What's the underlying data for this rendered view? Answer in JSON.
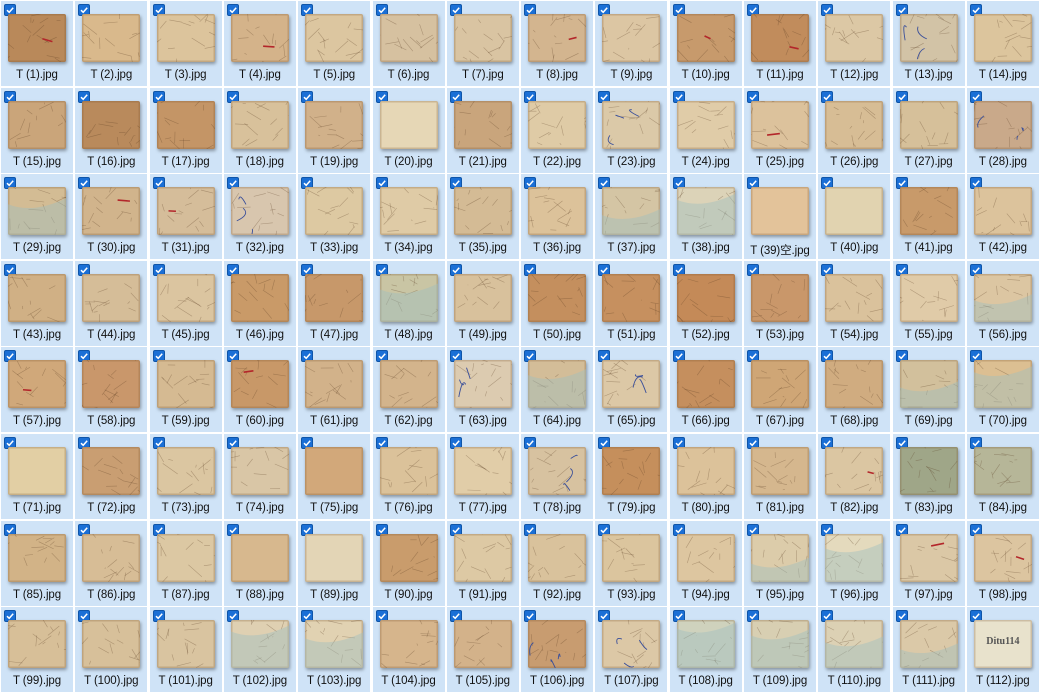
{
  "window": {
    "title": ""
  },
  "accent_color": "#1a6fd6",
  "selection_background": "#cfe3f7",
  "files": [
    {
      "name": "T (1).jpg",
      "selected": true,
      "tone": "#b9895a",
      "feature": "red"
    },
    {
      "name": "T (2).jpg",
      "selected": true,
      "tone": "#d9b98c",
      "feature": "lines"
    },
    {
      "name": "T (3).jpg",
      "selected": true,
      "tone": "#dcc49c",
      "feature": "lines"
    },
    {
      "name": "T (4).jpg",
      "selected": true,
      "tone": "#d4b38a",
      "feature": "red"
    },
    {
      "name": "T (5).jpg",
      "selected": true,
      "tone": "#dcc6a0",
      "feature": "lines"
    },
    {
      "name": "T (6).jpg",
      "selected": true,
      "tone": "#d6c1a0",
      "feature": "lines"
    },
    {
      "name": "T (7).jpg",
      "selected": true,
      "tone": "#d9c4a2",
      "feature": "lines"
    },
    {
      "name": "T (8).jpg",
      "selected": true,
      "tone": "#d3b58f",
      "feature": "red"
    },
    {
      "name": "T (9).jpg",
      "selected": true,
      "tone": "#dcc6a3",
      "feature": "lines"
    },
    {
      "name": "T (10).jpg",
      "selected": true,
      "tone": "#c79a6c",
      "feature": "red"
    },
    {
      "name": "T (11).jpg",
      "selected": true,
      "tone": "#c18c5c",
      "feature": "red"
    },
    {
      "name": "T (12).jpg",
      "selected": true,
      "tone": "#dcc8a5",
      "feature": "lines"
    },
    {
      "name": "T (13).jpg",
      "selected": true,
      "tone": "#d2c3a6",
      "feature": "blue"
    },
    {
      "name": "T (14).jpg",
      "selected": true,
      "tone": "#dcc59d",
      "feature": "lines"
    },
    {
      "name": "T (15).jpg",
      "selected": true,
      "tone": "#caa57a",
      "feature": "lines"
    },
    {
      "name": "T (16).jpg",
      "selected": true,
      "tone": "#b98a5c",
      "feature": "lines"
    },
    {
      "name": "T (17).jpg",
      "selected": true,
      "tone": "#c49566",
      "feature": "lines"
    },
    {
      "name": "T (18).jpg",
      "selected": true,
      "tone": "#d8c19b",
      "feature": "lines"
    },
    {
      "name": "T (19).jpg",
      "selected": true,
      "tone": "#d1b18a",
      "feature": "lines"
    },
    {
      "name": "T (20).jpg",
      "selected": true,
      "tone": "#e6d7b6",
      "feature": "plain"
    },
    {
      "name": "T (21).jpg",
      "selected": true,
      "tone": "#c9a57c",
      "feature": "lines"
    },
    {
      "name": "T (22).jpg",
      "selected": true,
      "tone": "#dfcba6",
      "feature": "lines"
    },
    {
      "name": "T (23).jpg",
      "selected": true,
      "tone": "#dbc9a8",
      "feature": "blue"
    },
    {
      "name": "T (24).jpg",
      "selected": true,
      "tone": "#e0cca8",
      "feature": "lines"
    },
    {
      "name": "T (25).jpg",
      "selected": true,
      "tone": "#dcc29c",
      "feature": "red"
    },
    {
      "name": "T (26).jpg",
      "selected": true,
      "tone": "#d7bd95",
      "feature": "lines"
    },
    {
      "name": "T (27).jpg",
      "selected": true,
      "tone": "#d6c09a",
      "feature": "lines"
    },
    {
      "name": "T (28).jpg",
      "selected": true,
      "tone": "#c9a98a",
      "feature": "blue"
    },
    {
      "name": "T (29).jpg",
      "selected": true,
      "tone": "#d3bc94",
      "feature": "water"
    },
    {
      "name": "T (30).jpg",
      "selected": true,
      "tone": "#d1b48c",
      "feature": "red"
    },
    {
      "name": "T (31).jpg",
      "selected": true,
      "tone": "#d5bd9a",
      "feature": "red"
    },
    {
      "name": "T (32).jpg",
      "selected": true,
      "tone": "#d8c6ae",
      "feature": "blue"
    },
    {
      "name": "T (33).jpg",
      "selected": true,
      "tone": "#ddc9a2",
      "feature": "lines"
    },
    {
      "name": "T (34).jpg",
      "selected": true,
      "tone": "#dfcba6",
      "feature": "lines"
    },
    {
      "name": "T (35).jpg",
      "selected": true,
      "tone": "#d4bb95",
      "feature": "lines"
    },
    {
      "name": "T (36).jpg",
      "selected": true,
      "tone": "#dcc29a",
      "feature": "lines"
    },
    {
      "name": "T (37).jpg",
      "selected": true,
      "tone": "#d4c5a4",
      "feature": "water"
    },
    {
      "name": "T (38).jpg",
      "selected": true,
      "tone": "#dcd3b8",
      "feature": "water"
    },
    {
      "name": "T (39)空.jpg",
      "selected": true,
      "tone": "#e3c39a",
      "feature": "plain"
    },
    {
      "name": "T (40).jpg",
      "selected": true,
      "tone": "#e1d3b0",
      "feature": "plain"
    },
    {
      "name": "T (41).jpg",
      "selected": true,
      "tone": "#c89a6a",
      "feature": "lines"
    },
    {
      "name": "T (42).jpg",
      "selected": true,
      "tone": "#dcc39c",
      "feature": "lines"
    },
    {
      "name": "T (43).jpg",
      "selected": true,
      "tone": "#d0b085",
      "feature": "lines"
    },
    {
      "name": "T (44).jpg",
      "selected": true,
      "tone": "#d5bd98",
      "feature": "lines"
    },
    {
      "name": "T (45).jpg",
      "selected": true,
      "tone": "#dbc5a0",
      "feature": "lines"
    },
    {
      "name": "T (46).jpg",
      "selected": true,
      "tone": "#c99a68",
      "feature": "lines"
    },
    {
      "name": "T (47).jpg",
      "selected": true,
      "tone": "#c7986a",
      "feature": "lines"
    },
    {
      "name": "T (48).jpg",
      "selected": true,
      "tone": "#c9c5a4",
      "feature": "water"
    },
    {
      "name": "T (49).jpg",
      "selected": true,
      "tone": "#d8c19c",
      "feature": "lines"
    },
    {
      "name": "T (50).jpg",
      "selected": true,
      "tone": "#c48f5e",
      "feature": "lines"
    },
    {
      "name": "T (51).jpg",
      "selected": true,
      "tone": "#c6905f",
      "feature": "lines"
    },
    {
      "name": "T (52).jpg",
      "selected": true,
      "tone": "#c48a58",
      "feature": "lines"
    },
    {
      "name": "T (53).jpg",
      "selected": true,
      "tone": "#c9976a",
      "feature": "lines"
    },
    {
      "name": "T (54).jpg",
      "selected": true,
      "tone": "#dac29c",
      "feature": "lines"
    },
    {
      "name": "T (55).jpg",
      "selected": true,
      "tone": "#e0cba8",
      "feature": "lines"
    },
    {
      "name": "T (56).jpg",
      "selected": true,
      "tone": "#dcc6a2",
      "feature": "water"
    },
    {
      "name": "T (57).jpg",
      "selected": true,
      "tone": "#d0a87a",
      "feature": "red"
    },
    {
      "name": "T (58).jpg",
      "selected": true,
      "tone": "#c9976b",
      "feature": "lines"
    },
    {
      "name": "T (59).jpg",
      "selected": true,
      "tone": "#d5ba92",
      "feature": "lines"
    },
    {
      "name": "T (60).jpg",
      "selected": true,
      "tone": "#c89868",
      "feature": "red"
    },
    {
      "name": "T (61).jpg",
      "selected": true,
      "tone": "#d2b28a",
      "feature": "lines"
    },
    {
      "name": "T (62).jpg",
      "selected": true,
      "tone": "#d3b48c",
      "feature": "lines"
    },
    {
      "name": "T (63).jpg",
      "selected": true,
      "tone": "#dccbb0",
      "feature": "blue"
    },
    {
      "name": "T (64).jpg",
      "selected": true,
      "tone": "#d3bd98",
      "feature": "water"
    },
    {
      "name": "T (65).jpg",
      "selected": true,
      "tone": "#dcc8a6",
      "feature": "blue"
    },
    {
      "name": "T (66).jpg",
      "selected": true,
      "tone": "#c58f5e",
      "feature": "lines"
    },
    {
      "name": "T (67).jpg",
      "selected": true,
      "tone": "#cfa676",
      "feature": "lines"
    },
    {
      "name": "T (68).jpg",
      "selected": true,
      "tone": "#d0ac80",
      "feature": "lines"
    },
    {
      "name": "T (69).jpg",
      "selected": true,
      "tone": "#d2c09c",
      "feature": "water"
    },
    {
      "name": "T (70).jpg",
      "selected": true,
      "tone": "#dcbf92",
      "feature": "water"
    },
    {
      "name": "T (71).jpg",
      "selected": true,
      "tone": "#e2cfa4",
      "feature": "plain"
    },
    {
      "name": "T (72).jpg",
      "selected": true,
      "tone": "#c99e72",
      "feature": "lines"
    },
    {
      "name": "T (73).jpg",
      "selected": true,
      "tone": "#dbc6a1",
      "feature": "lines"
    },
    {
      "name": "T (74).jpg",
      "selected": true,
      "tone": "#d9c6a6",
      "feature": "lines"
    },
    {
      "name": "T (75).jpg",
      "selected": true,
      "tone": "#d2a87a",
      "feature": "plain"
    },
    {
      "name": "T (76).jpg",
      "selected": true,
      "tone": "#dbc29a",
      "feature": "lines"
    },
    {
      "name": "T (77).jpg",
      "selected": true,
      "tone": "#e1cda8",
      "feature": "lines"
    },
    {
      "name": "T (78).jpg",
      "selected": true,
      "tone": "#d7c2a0",
      "feature": "blue"
    },
    {
      "name": "T (79).jpg",
      "selected": true,
      "tone": "#c58f5c",
      "feature": "lines"
    },
    {
      "name": "T (80).jpg",
      "selected": true,
      "tone": "#dcc29a",
      "feature": "lines"
    },
    {
      "name": "T (81).jpg",
      "selected": true,
      "tone": "#d5b78e",
      "feature": "lines"
    },
    {
      "name": "T (82).jpg",
      "selected": true,
      "tone": "#dbc6a2",
      "feature": "red"
    },
    {
      "name": "T (83).jpg",
      "selected": true,
      "tone": "#9fa688",
      "feature": "lines"
    },
    {
      "name": "T (84).jpg",
      "selected": true,
      "tone": "#b6b698",
      "feature": "lines"
    },
    {
      "name": "T (85).jpg",
      "selected": true,
      "tone": "#d2b387",
      "feature": "lines"
    },
    {
      "name": "T (86).jpg",
      "selected": true,
      "tone": "#d7bd96",
      "feature": "lines"
    },
    {
      "name": "T (87).jpg",
      "selected": true,
      "tone": "#dcc8a3",
      "feature": "lines"
    },
    {
      "name": "T (88).jpg",
      "selected": true,
      "tone": "#d7b88e",
      "feature": "plain"
    },
    {
      "name": "T (89).jpg",
      "selected": true,
      "tone": "#e3d5b6",
      "feature": "plain"
    },
    {
      "name": "T (90).jpg",
      "selected": true,
      "tone": "#c99c6c",
      "feature": "lines"
    },
    {
      "name": "T (91).jpg",
      "selected": true,
      "tone": "#ddc9a4",
      "feature": "lines"
    },
    {
      "name": "T (92).jpg",
      "selected": true,
      "tone": "#d9c29c",
      "feature": "lines"
    },
    {
      "name": "T (93).jpg",
      "selected": true,
      "tone": "#dbc59e",
      "feature": "lines"
    },
    {
      "name": "T (94).jpg",
      "selected": true,
      "tone": "#ddc6a0",
      "feature": "lines"
    },
    {
      "name": "T (95).jpg",
      "selected": true,
      "tone": "#dcccaa",
      "feature": "water"
    },
    {
      "name": "T (96).jpg",
      "selected": true,
      "tone": "#e4dabd",
      "feature": "water"
    },
    {
      "name": "T (97).jpg",
      "selected": true,
      "tone": "#dbc8a6",
      "feature": "red"
    },
    {
      "name": "T (98).jpg",
      "selected": true,
      "tone": "#dcc5a0",
      "feature": "red"
    },
    {
      "name": "T (99).jpg",
      "selected": true,
      "tone": "#d7bf98",
      "feature": "lines"
    },
    {
      "name": "T (100).jpg",
      "selected": true,
      "tone": "#d7c09a",
      "feature": "lines"
    },
    {
      "name": "T (101).jpg",
      "selected": true,
      "tone": "#d9c4a0",
      "feature": "lines"
    },
    {
      "name": "T (102).jpg",
      "selected": true,
      "tone": "#dfd0b2",
      "feature": "water"
    },
    {
      "name": "T (103).jpg",
      "selected": true,
      "tone": "#e1d2b2",
      "feature": "water"
    },
    {
      "name": "T (104).jpg",
      "selected": true,
      "tone": "#d6b58c",
      "feature": "lines"
    },
    {
      "name": "T (105).jpg",
      "selected": true,
      "tone": "#d3b28a",
      "feature": "lines"
    },
    {
      "name": "T (106).jpg",
      "selected": true,
      "tone": "#c89c70",
      "feature": "blue"
    },
    {
      "name": "T (107).jpg",
      "selected": true,
      "tone": "#dcc8a6",
      "feature": "blue"
    },
    {
      "name": "T (108).jpg",
      "selected": true,
      "tone": "#cfd2bd",
      "feature": "water"
    },
    {
      "name": "T (109).jpg",
      "selected": true,
      "tone": "#d8cfb2",
      "feature": "water"
    },
    {
      "name": "T (110).jpg",
      "selected": true,
      "tone": "#dcd1b4",
      "feature": "water"
    },
    {
      "name": "T (111).jpg",
      "selected": true,
      "tone": "#dbc9a8",
      "feature": "water"
    },
    {
      "name": "T (112).jpg",
      "selected": true,
      "tone": "#e8e2cc",
      "feature": "watermark",
      "watermark": "Ditu114"
    }
  ]
}
